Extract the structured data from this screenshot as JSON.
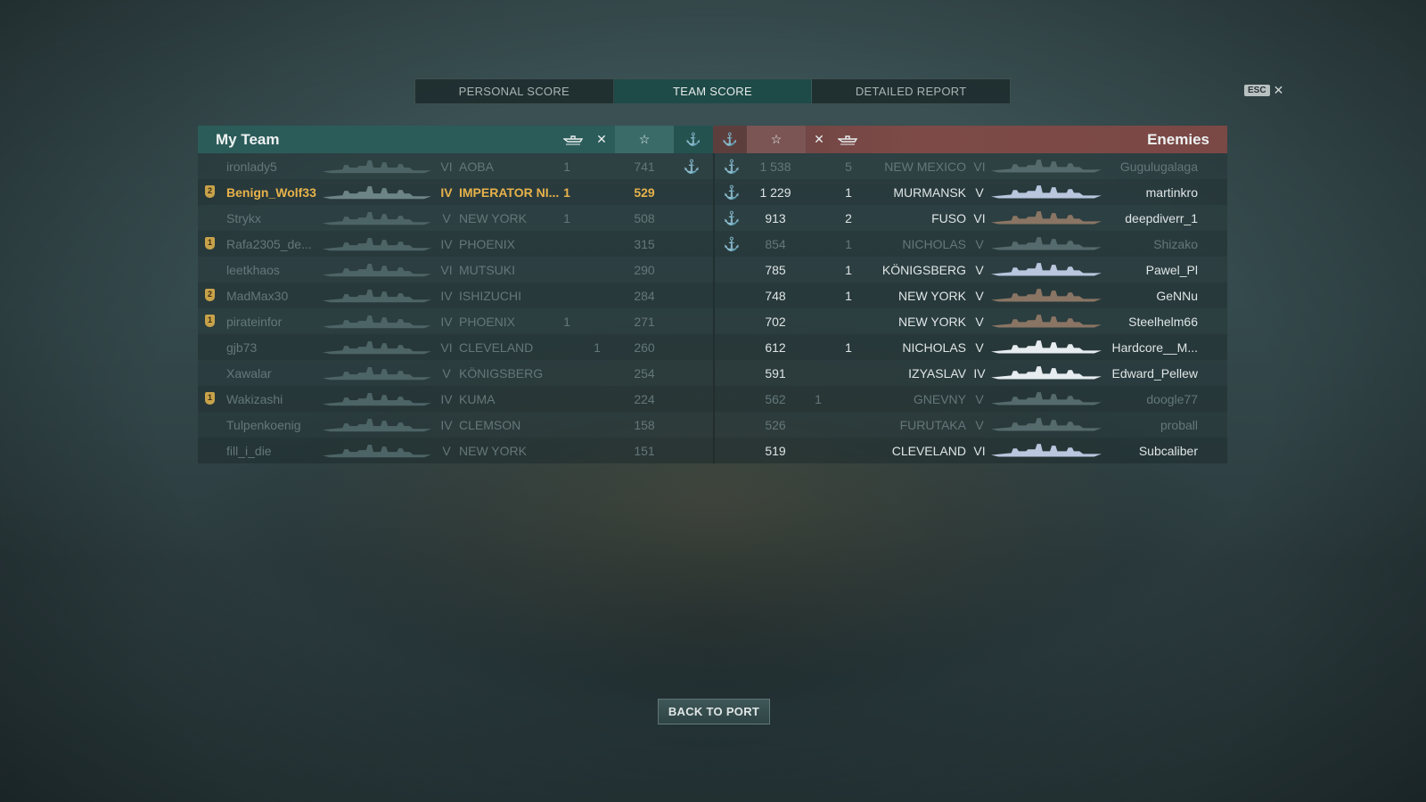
{
  "tabs": [
    {
      "label": "PERSONAL SCORE",
      "active": false
    },
    {
      "label": "TEAM SCORE",
      "active": true
    },
    {
      "label": "DETAILED REPORT",
      "active": false
    }
  ],
  "close": {
    "key": "ESC",
    "symbol": "✕"
  },
  "my_team": {
    "title": "My Team",
    "header_icons": [
      "ship-frags-icon",
      "planes-shot-icon",
      "star-score-icon",
      "anchor-base-icon"
    ],
    "rows": [
      {
        "badge": "",
        "name": "ironlady5",
        "tier": "VI",
        "ship": "AOBA",
        "frags": "1",
        "planes": "",
        "score": "741",
        "base": "⚓",
        "status": "dead"
      },
      {
        "badge": "2",
        "name": "Benign_Wolf33",
        "tier": "IV",
        "ship": "IMPERATOR NI...",
        "frags": "1",
        "planes": "",
        "score": "529",
        "base": "",
        "status": "me"
      },
      {
        "badge": "",
        "name": "Strykx",
        "tier": "V",
        "ship": "NEW YORK",
        "frags": "1",
        "planes": "",
        "score": "508",
        "base": "",
        "status": "dead"
      },
      {
        "badge": "1",
        "name": "Rafa2305_de...",
        "tier": "IV",
        "ship": "PHOENIX",
        "frags": "",
        "planes": "",
        "score": "315",
        "base": "",
        "status": "dead"
      },
      {
        "badge": "",
        "name": "leetkhaos",
        "tier": "VI",
        "ship": "MUTSUKI",
        "frags": "",
        "planes": "",
        "score": "290",
        "base": "",
        "status": "dead"
      },
      {
        "badge": "2",
        "name": "MadMax30",
        "tier": "IV",
        "ship": "ISHIZUCHI",
        "frags": "",
        "planes": "",
        "score": "284",
        "base": "",
        "status": "dead"
      },
      {
        "badge": "1",
        "name": "pirateinfor",
        "tier": "IV",
        "ship": "PHOENIX",
        "frags": "1",
        "planes": "",
        "score": "271",
        "base": "",
        "status": "dead"
      },
      {
        "badge": "",
        "name": "gjb73",
        "tier": "VI",
        "ship": "CLEVELAND",
        "frags": "",
        "planes": "1",
        "score": "260",
        "base": "",
        "status": "dead"
      },
      {
        "badge": "",
        "name": "Xawalar",
        "tier": "V",
        "ship": "KÖNIGSBERG",
        "frags": "",
        "planes": "",
        "score": "254",
        "base": "",
        "status": "dead"
      },
      {
        "badge": "1",
        "name": "Wakizashi",
        "tier": "IV",
        "ship": "KUMA",
        "frags": "",
        "planes": "",
        "score": "224",
        "base": "",
        "status": "dead"
      },
      {
        "badge": "",
        "name": "Tulpenkoenig",
        "tier": "IV",
        "ship": "CLEMSON",
        "frags": "",
        "planes": "",
        "score": "158",
        "base": "",
        "status": "dead"
      },
      {
        "badge": "",
        "name": "fill_i_die",
        "tier": "V",
        "ship": "NEW YORK",
        "frags": "",
        "planes": "",
        "score": "151",
        "base": "",
        "status": "dead"
      }
    ]
  },
  "enemies": {
    "title": "Enemies",
    "header_icons": [
      "anchor-base-icon",
      "star-score-icon",
      "planes-shot-icon",
      "ship-frags-icon"
    ],
    "rows": [
      {
        "base": "⚓",
        "score": "1 538",
        "planes": "",
        "frags": "5",
        "ship": "NEW MEXICO",
        "tier": "VI",
        "name": "Gugulugalaga",
        "status": "dead",
        "color": "#556a6c"
      },
      {
        "base": "⚓",
        "score": "1 229",
        "planes": "",
        "frags": "1",
        "ship": "MURMANSK",
        "tier": "V",
        "name": "martinkro",
        "status": "alive",
        "color": "#b9c6de"
      },
      {
        "base": "⚓",
        "score": "913",
        "planes": "",
        "frags": "2",
        "ship": "FUSO",
        "tier": "VI",
        "name": "deepdiverr_1",
        "status": "alive",
        "color": "#8a7564"
      },
      {
        "base": "⚓",
        "score": "854",
        "planes": "",
        "frags": "1",
        "ship": "NICHOLAS",
        "tier": "V",
        "name": "Shizako",
        "status": "dead",
        "color": "#556a6c"
      },
      {
        "base": "",
        "score": "785",
        "planes": "",
        "frags": "1",
        "ship": "KÖNIGSBERG",
        "tier": "V",
        "name": "Pawel_Pl",
        "status": "alive",
        "color": "#b9c6de"
      },
      {
        "base": "",
        "score": "748",
        "planes": "",
        "frags": "1",
        "ship": "NEW YORK",
        "tier": "V",
        "name": "GeNNu",
        "status": "alive",
        "color": "#8a7564"
      },
      {
        "base": "",
        "score": "702",
        "planes": "",
        "frags": "",
        "ship": "NEW YORK",
        "tier": "V",
        "name": "Steelhelm66",
        "status": "alive",
        "color": "#8a7564"
      },
      {
        "base": "",
        "score": "612",
        "planes": "",
        "frags": "1",
        "ship": "NICHOLAS",
        "tier": "V",
        "name": "Hardcore__M...",
        "status": "alive",
        "color": "#e6ecf0"
      },
      {
        "base": "",
        "score": "591",
        "planes": "",
        "frags": "",
        "ship": "IZYASLAV",
        "tier": "IV",
        "name": "Edward_Pellew",
        "status": "alive",
        "color": "#e6ecf0"
      },
      {
        "base": "",
        "score": "562",
        "planes": "1",
        "frags": "",
        "ship": "GNEVNY",
        "tier": "V",
        "name": "doogle77",
        "status": "dead",
        "color": "#556a6c"
      },
      {
        "base": "",
        "score": "526",
        "planes": "",
        "frags": "",
        "ship": "FURUTAKA",
        "tier": "V",
        "name": "proball",
        "status": "dead",
        "color": "#556a6c"
      },
      {
        "base": "",
        "score": "519",
        "planes": "",
        "frags": "",
        "ship": "CLEVELAND",
        "tier": "VI",
        "name": "Subcaliber",
        "status": "alive",
        "color": "#b9c6de"
      }
    ]
  },
  "footer": {
    "back_label": "BACK TO PORT"
  }
}
